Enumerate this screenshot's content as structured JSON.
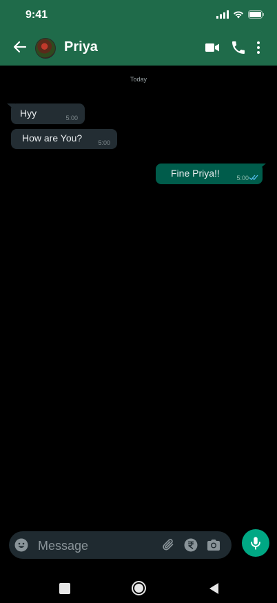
{
  "status_bar": {
    "time": "9:41"
  },
  "contact": {
    "name": "Priya"
  },
  "chat": {
    "date_separator": "Today",
    "messages": [
      {
        "direction": "incoming",
        "text": "Hyy",
        "time": "5:00"
      },
      {
        "direction": "incoming",
        "text": "How are You?",
        "time": "5:00"
      },
      {
        "direction": "outgoing",
        "text": "Fine Priya!!",
        "time": "5:00",
        "status": "read"
      }
    ]
  },
  "composer": {
    "placeholder": "Message"
  },
  "icons": {
    "back": "arrow-left-icon",
    "video": "video-camera-icon",
    "call": "phone-icon",
    "more": "more-vertical-icon",
    "emoji": "emoji-icon",
    "attach": "paperclip-icon",
    "payment": "rupee-icon",
    "camera": "camera-icon",
    "mic": "microphone-icon"
  },
  "colors": {
    "header": "#1f6b4a",
    "incoming_bubble": "#232d33",
    "outgoing_bubble": "#005c4b",
    "accent": "#00a884",
    "read_ticks": "#53bdeb"
  }
}
